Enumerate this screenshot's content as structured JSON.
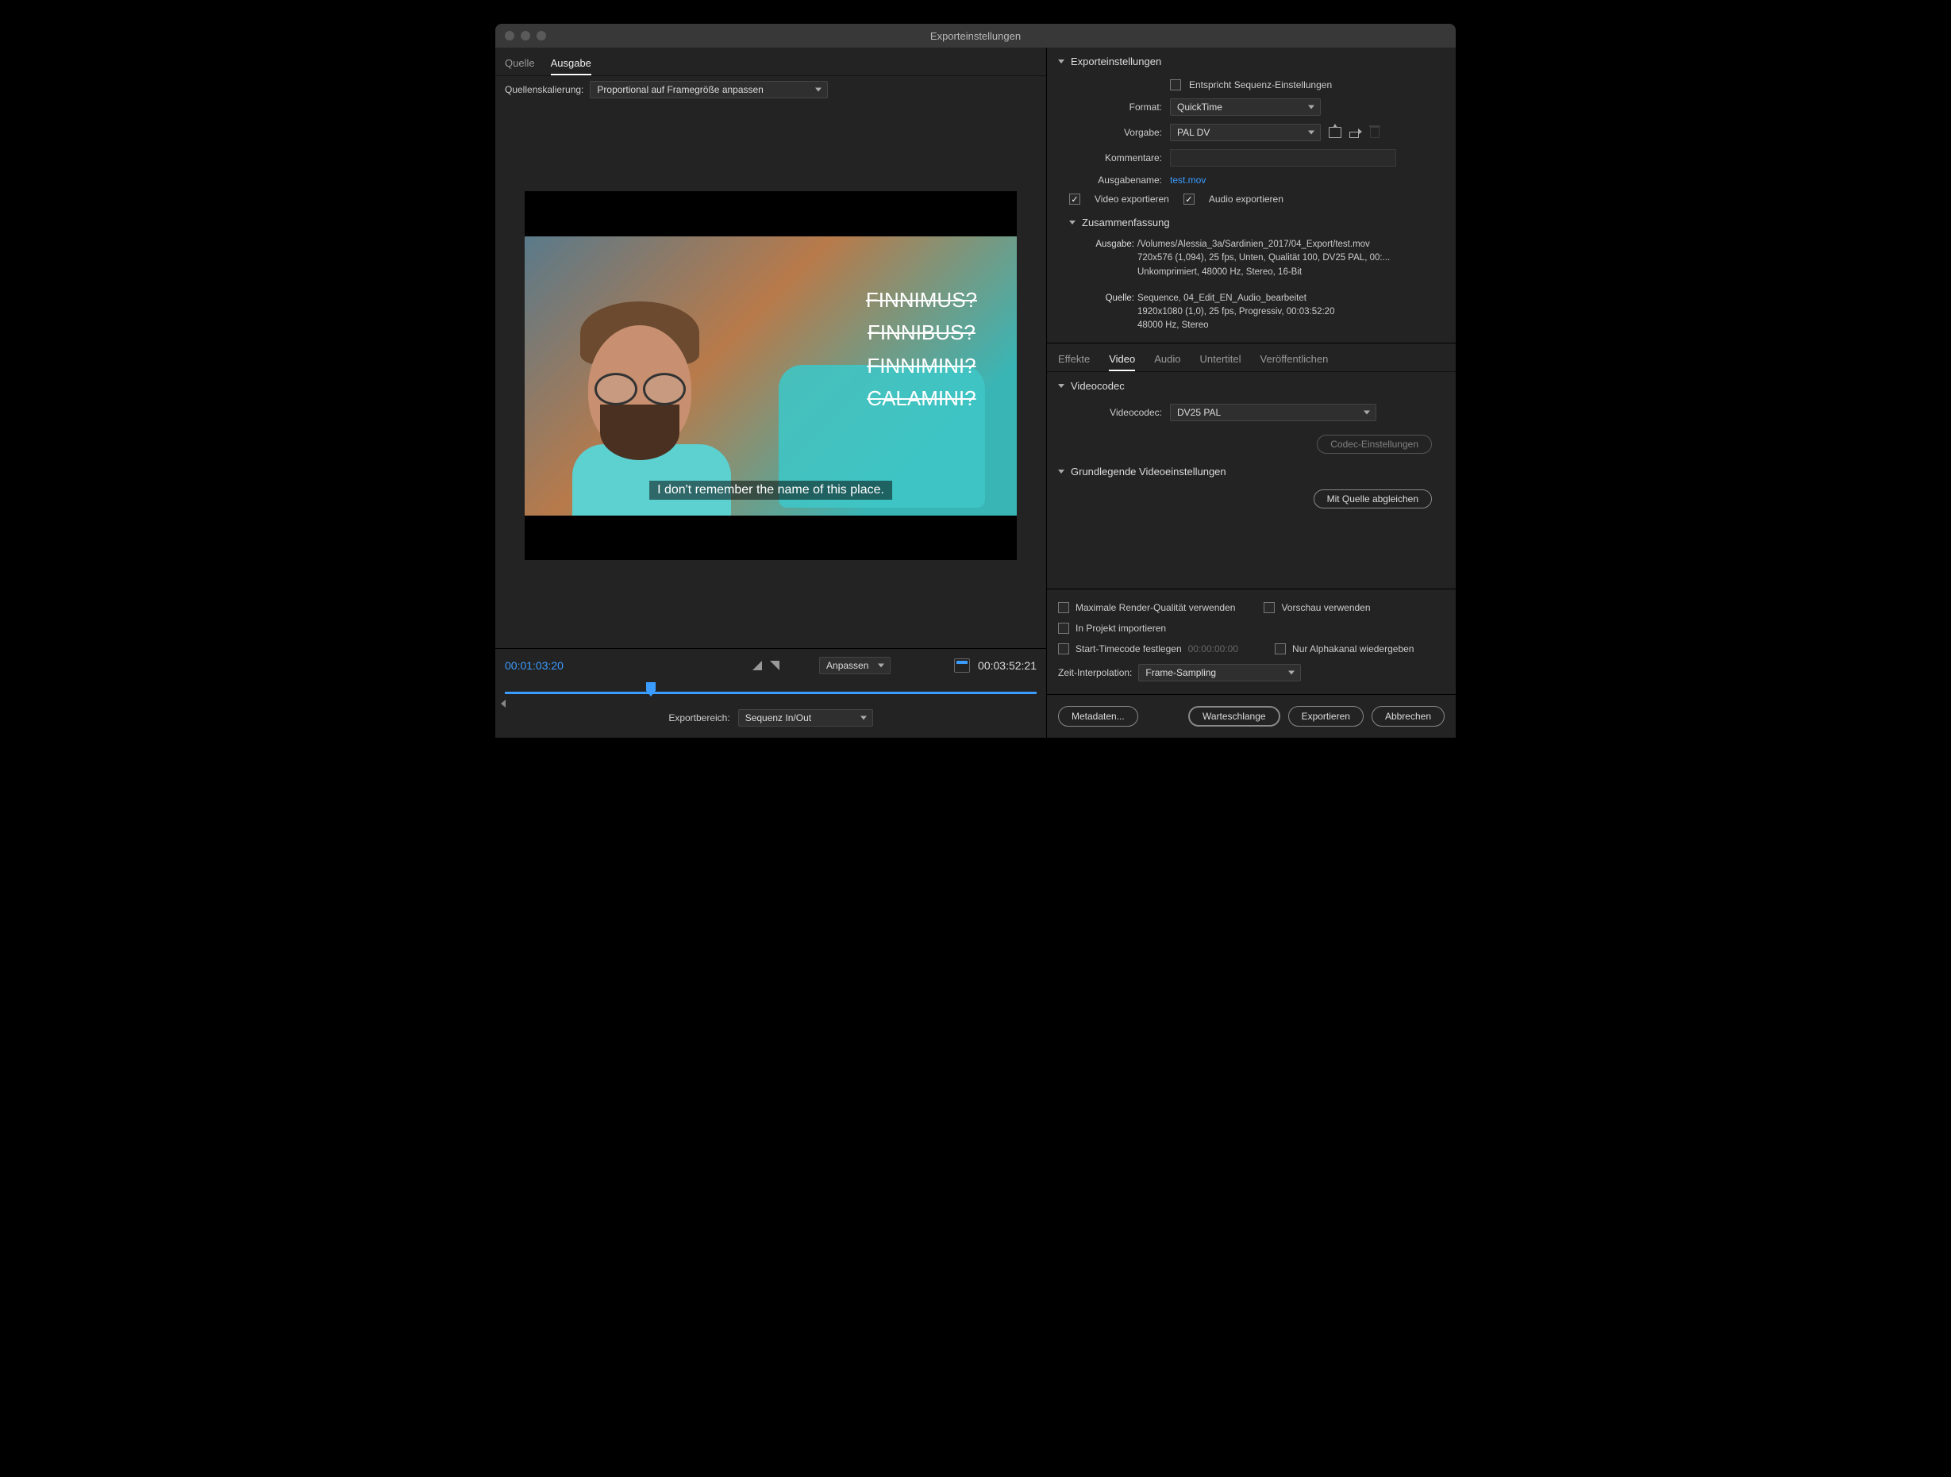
{
  "window": {
    "title": "Exporteinstellungen"
  },
  "left": {
    "tabs": {
      "source": "Quelle",
      "output": "Ausgabe"
    },
    "scaling_label": "Quellenskalierung:",
    "scaling_value": "Proportional auf Framegröße anpassen",
    "overlay": {
      "l1": "FINNIMUS?",
      "l2": "FINNIBUS?",
      "l3": "FINNIMINI?",
      "l4": "CALAMINI?"
    },
    "subtitle": "I don't remember the name of this place.",
    "time_in": "00:01:03:20",
    "time_out": "00:03:52:21",
    "fit_label": "Anpassen",
    "range_label": "Exportbereich:",
    "range_value": "Sequenz In/Out"
  },
  "right": {
    "header": "Exporteinstellungen",
    "match": "Entspricht Sequenz-Einstellungen",
    "format_label": "Format:",
    "format_value": "QuickTime",
    "preset_label": "Vorgabe:",
    "preset_value": "PAL DV",
    "comments_label": "Kommentare:",
    "outname_label": "Ausgabename:",
    "outname_value": "test.mov",
    "export_video": "Video exportieren",
    "export_audio": "Audio exportieren",
    "summary_header": "Zusammenfassung",
    "summary_out_label": "Ausgabe:",
    "summary_out_l1": "/Volumes/Alessia_3a/Sardinien_2017/04_Export/test.mov",
    "summary_out_l2": "720x576 (1,094), 25 fps, Unten, Qualität 100, DV25 PAL, 00:...",
    "summary_out_l3": "Unkomprimiert, 48000 Hz, Stereo, 16-Bit",
    "summary_src_label": "Quelle:",
    "summary_src_l1": "Sequence, 04_Edit_EN_Audio_bearbeitet",
    "summary_src_l2": "1920x1080 (1,0), 25 fps, Progressiv, 00:03:52:20",
    "summary_src_l3": "48000 Hz, Stereo",
    "subtabs": {
      "effects": "Effekte",
      "video": "Video",
      "audio": "Audio",
      "captions": "Untertitel",
      "publish": "Veröffentlichen"
    },
    "codec_header": "Videocodec",
    "codec_label": "Videocodec:",
    "codec_value": "DV25 PAL",
    "codec_settings": "Codec-Einstellungen",
    "basic_header": "Grundlegende Videoeinstellungen",
    "match_source": "Mit Quelle abgleichen",
    "max_render": "Maximale Render-Qualität verwenden",
    "use_preview": "Vorschau verwenden",
    "import_project": "In Projekt importieren",
    "start_tc": "Start-Timecode festlegen",
    "start_tc_val": "00:00:00:00",
    "alpha_only": "Nur Alphakanal wiedergeben",
    "interp_label": "Zeit-Interpolation:",
    "interp_value": "Frame-Sampling",
    "btn_metadata": "Metadaten...",
    "btn_queue": "Warteschlange",
    "btn_export": "Exportieren",
    "btn_cancel": "Abbrechen"
  }
}
